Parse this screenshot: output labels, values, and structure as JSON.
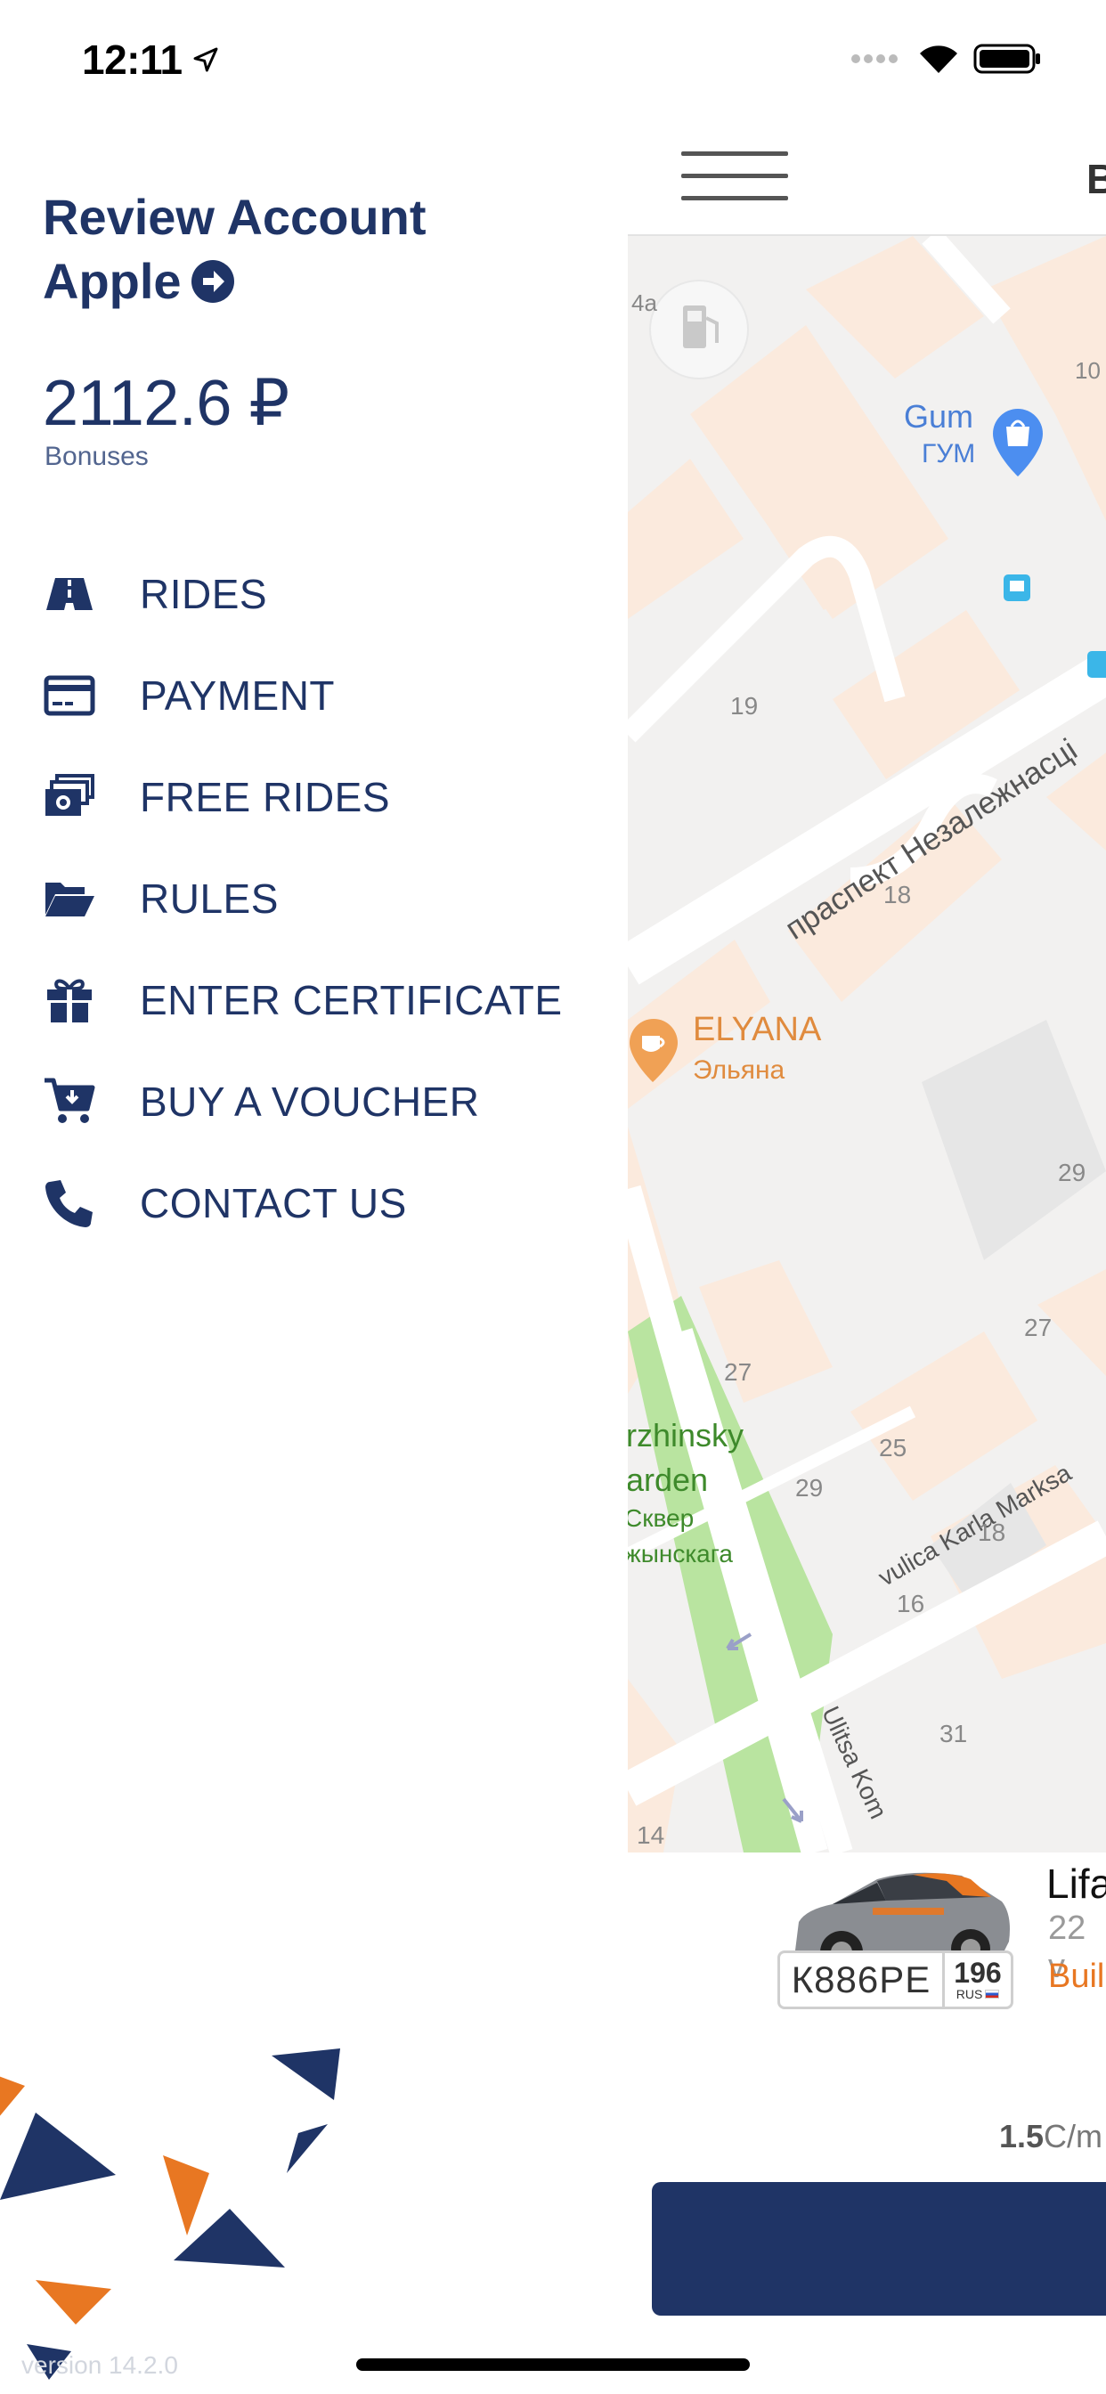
{
  "status_bar": {
    "time": "12:11"
  },
  "drawer": {
    "account_name_line1": "Review Account",
    "account_name_line2": "Apple",
    "balance": "2112.6 ₽",
    "balance_label": "Bonuses",
    "menu": [
      {
        "label": "RIDES",
        "icon": "road-icon"
      },
      {
        "label": "PAYMENT",
        "icon": "credit-card-icon"
      },
      {
        "label": "FREE RIDES",
        "icon": "money-bills-icon"
      },
      {
        "label": "RULES",
        "icon": "folder-open-icon"
      },
      {
        "label": "ENTER CERTIFICATE",
        "icon": "gift-icon"
      },
      {
        "label": "BUY A VOUCHER",
        "icon": "cart-download-icon"
      },
      {
        "label": "CONTACT US",
        "icon": "phone-icon"
      }
    ],
    "version": "version 14.2.0"
  },
  "main": {
    "header_title": "B",
    "map": {
      "labels": {
        "house_4a": "4a",
        "house_10": "10",
        "gum_en": "Gum",
        "gum_ru": "ГУМ",
        "house_19": "19",
        "street_nezalezhnasci": "праспект Незалежнасці",
        "house_18a": "18",
        "elyana_en": "ELYANA",
        "elyana_ru": "Эльяна",
        "house_29a": "29",
        "house_27a": "27",
        "house_27b": "27",
        "garden_en1": "rzhinsky",
        "garden_en2": "arden",
        "garden_ru1": "Сквер",
        "garden_ru2": "жынскага",
        "house_25": "25",
        "house_29b": "29",
        "street_karla_marksa": "vulica Karla Marksa",
        "house_18b": "18",
        "house_16": "16",
        "house_31": "31",
        "street_ulitsa_kom": "Ulitsa Kom",
        "house_14": "14"
      }
    },
    "car": {
      "plate_number": "К886РЕ",
      "plate_region": "196",
      "plate_country": "RUS",
      "name": "Lifa",
      "subtitle": "22 v",
      "status": "Buil"
    },
    "price": {
      "value": "1.5",
      "unit": "C/m"
    }
  },
  "colors": {
    "brand_navy": "#1f3466",
    "brand_orange": "#e87722",
    "map_park": "#b9e4a0",
    "map_building": "#fbeadd"
  }
}
